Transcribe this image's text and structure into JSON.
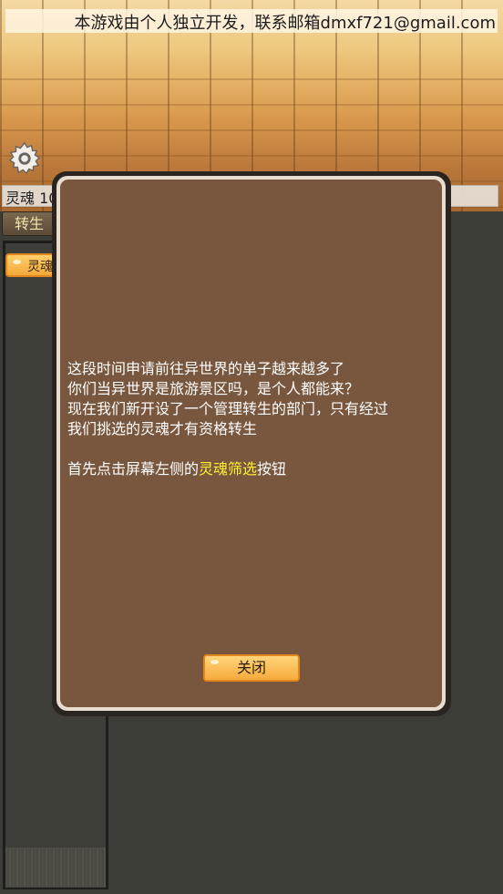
{
  "header": {
    "notice": "本游戏由个人独立开发，联系邮箱dmxf721@gmail.com"
  },
  "settings": {
    "icon": "gear-icon"
  },
  "resources": {
    "soul_label": "灵魂 10"
  },
  "tabs": {
    "reincarnate_label": "转生"
  },
  "sidebar": {
    "filter_button_label": "灵魂"
  },
  "dialog": {
    "line1": "这段时间申请前往异世界的单子越来越多了",
    "line2": "你们当异世界是旅游景区吗，是个人都能来？",
    "line3": "现在我们新开设了一个管理转生的部门，只有经过",
    "line4": "我们挑选的灵魂才有资格转生",
    "instruction_prefix": "首先点击屏幕左侧的",
    "instruction_highlight": "灵魂筛选",
    "instruction_suffix": "按钮",
    "close_label": "关闭",
    "highlight_color": "#ffee33",
    "background_color": "#79573e"
  }
}
